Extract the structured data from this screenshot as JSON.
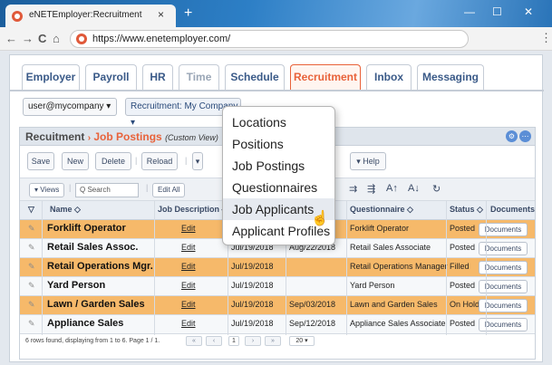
{
  "browser": {
    "tab_title": "eNETEmployer:Recruitment",
    "tab_close": "×",
    "new_tab": "+",
    "minimize": "—",
    "maximize": "☐",
    "close": "✕",
    "back": "←",
    "forward": "→",
    "reload": "C",
    "home": "⌂",
    "url": "https://www.enetemployer.com/",
    "menu": "⋮"
  },
  "nav": {
    "tabs": [
      {
        "label": "Employer",
        "state": "normal"
      },
      {
        "label": "Payroll",
        "state": "normal"
      },
      {
        "label": "HR",
        "state": "normal"
      },
      {
        "label": "Time",
        "state": "disabled"
      },
      {
        "label": "Schedule",
        "state": "normal"
      },
      {
        "label": "Recruitment",
        "state": "active"
      },
      {
        "label": "Inbox",
        "state": "normal"
      },
      {
        "label": "Messaging",
        "state": "normal"
      }
    ]
  },
  "selectors": {
    "user": "user@mycompany ▾",
    "company": "Recruitment: My Company ▾"
  },
  "panel": {
    "title": "Recuitment",
    "arrow": "›",
    "subtitle": "Job Postings",
    "view": "(Custom View)"
  },
  "actions": {
    "save": "Save",
    "new": "New",
    "delete": "Delete",
    "reload": "Reload",
    "help": "▾ Help"
  },
  "table_toolbar": {
    "views": "▾ Views",
    "search_placeholder": "Q Search",
    "edit_all": "Edit All",
    "format_icons": [
      "⇉",
      "⇶",
      "A↑",
      "A↓",
      "↻"
    ]
  },
  "table": {
    "headers": [
      "▽",
      "Name ◇",
      "Job Description ◇",
      "",
      "",
      "Questionnaire ◇",
      "Status ◇",
      "Documents"
    ],
    "rows": [
      {
        "name": "Forklift Operator",
        "desc": "Edit",
        "date1": "",
        "date2": "",
        "questionnaire": "Forklift Operator",
        "status": "Posted",
        "docs": "Documents",
        "highlight": true
      },
      {
        "name": "Retail Sales Assoc.",
        "desc": "Edit",
        "date1": "Jul/19/2018",
        "date2": "Aug/22/2018",
        "questionnaire": "Retail Sales Associate",
        "status": "Posted",
        "docs": "Documents",
        "highlight": false
      },
      {
        "name": "Retail Operations Mgr.",
        "desc": "Edit",
        "date1": "Jul/19/2018",
        "date2": "",
        "questionnaire": "Retail Operations Manager",
        "status": "Filled",
        "docs": "Documents",
        "highlight": true
      },
      {
        "name": "Yard Person",
        "desc": "Edit",
        "date1": "Jul/19/2018",
        "date2": "",
        "questionnaire": "Yard Person",
        "status": "Posted",
        "docs": "Documents",
        "highlight": false
      },
      {
        "name": "Lawn / Garden Sales",
        "desc": "Edit",
        "date1": "Jul/19/2018",
        "date2": "Sep/03/2018",
        "questionnaire": "Lawn and Garden Sales",
        "status": "On Hold",
        "docs": "Documents",
        "highlight": true
      },
      {
        "name": "Appliance Sales",
        "desc": "Edit",
        "date1": "Jul/19/2018",
        "date2": "Sep/12/2018",
        "questionnaire": "Appliance Sales Associate",
        "status": "Posted",
        "docs": "Documents",
        "highlight": false
      }
    ]
  },
  "footer": {
    "text": "6 rows found, displaying from 1 to 6. Page 1 / 1.",
    "page": "1",
    "page_size": "20 ▾"
  },
  "dropdown_menu": {
    "items": [
      "Locations",
      "Positions",
      "Job Postings",
      "Questionnaires",
      "Job Applicants",
      "Applicant Profiles"
    ],
    "hovered_index": 4
  },
  "colors": {
    "accent": "#e8623a",
    "highlight_row": "#f6b96a",
    "nav_text": "#3a5a88"
  }
}
